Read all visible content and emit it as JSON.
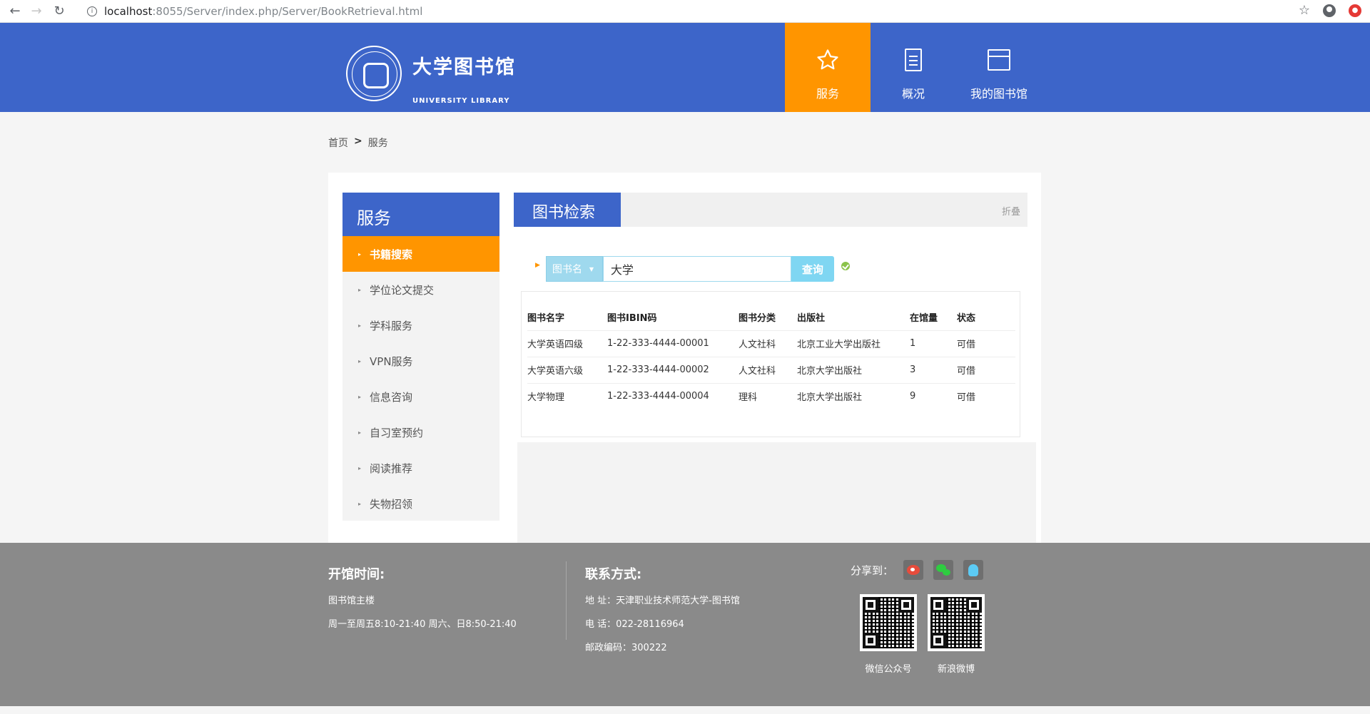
{
  "browser": {
    "url_host": "localhost",
    "url_path": ":8055/Server/index.php/Server/BookRetrieval.html"
  },
  "header": {
    "brand_cn": "大学图书馆",
    "brand_en": "UNIVERSITY LIBRARY",
    "nav": [
      {
        "label": "服务",
        "icon": "star-icon",
        "active": true
      },
      {
        "label": "概况",
        "icon": "document-icon",
        "active": false
      },
      {
        "label": "我的图书馆",
        "icon": "calendar-icon",
        "active": false
      }
    ]
  },
  "breadcrumb": {
    "home": "首页",
    "sep": ">",
    "current": "服务"
  },
  "sidebar": {
    "title": "服务",
    "items": [
      {
        "label": "书籍搜索",
        "active": true
      },
      {
        "label": "学位论文提交",
        "active": false
      },
      {
        "label": "学科服务",
        "active": false
      },
      {
        "label": "VPN服务",
        "active": false
      },
      {
        "label": "信息咨询",
        "active": false
      },
      {
        "label": "自习室预约",
        "active": false
      },
      {
        "label": "阅读推荐",
        "active": false
      },
      {
        "label": "失物招领",
        "active": false
      }
    ]
  },
  "content": {
    "title": "图书检索",
    "fold_label": "折叠",
    "search": {
      "category": "图书名",
      "value": "大学",
      "button": "查询"
    },
    "table": {
      "headers": [
        "图书名字",
        "图书IBIN码",
        "图书分类",
        "出版社",
        "在馆量",
        "状态"
      ],
      "rows": [
        [
          "大学英语四级",
          "1-22-333-4444-00001",
          "人文社科",
          "北京工业大学出版社",
          "1",
          "可借"
        ],
        [
          "大学英语六级",
          "1-22-333-4444-00002",
          "人文社科",
          "北京大学出版社",
          "3",
          "可借"
        ],
        [
          "大学物理",
          "1-22-333-4444-00004",
          "理科",
          "北京大学出版社",
          "9",
          "可借"
        ]
      ]
    }
  },
  "footer": {
    "hours_title": "开馆时间:",
    "hours_building": "图书馆主楼",
    "hours_times": "周一至周五8:10-21:40 周六、日8:50-21:40",
    "contact_title": "联系方式:",
    "address": "地 址：天津职业技术师范大学-图书馆",
    "phone": "电 话：022-28116964",
    "postcode": "邮政编码：300222",
    "share_label": "分享到：",
    "qr_wechat_label": "微信公众号",
    "qr_weibo_label": "新浪微博"
  }
}
